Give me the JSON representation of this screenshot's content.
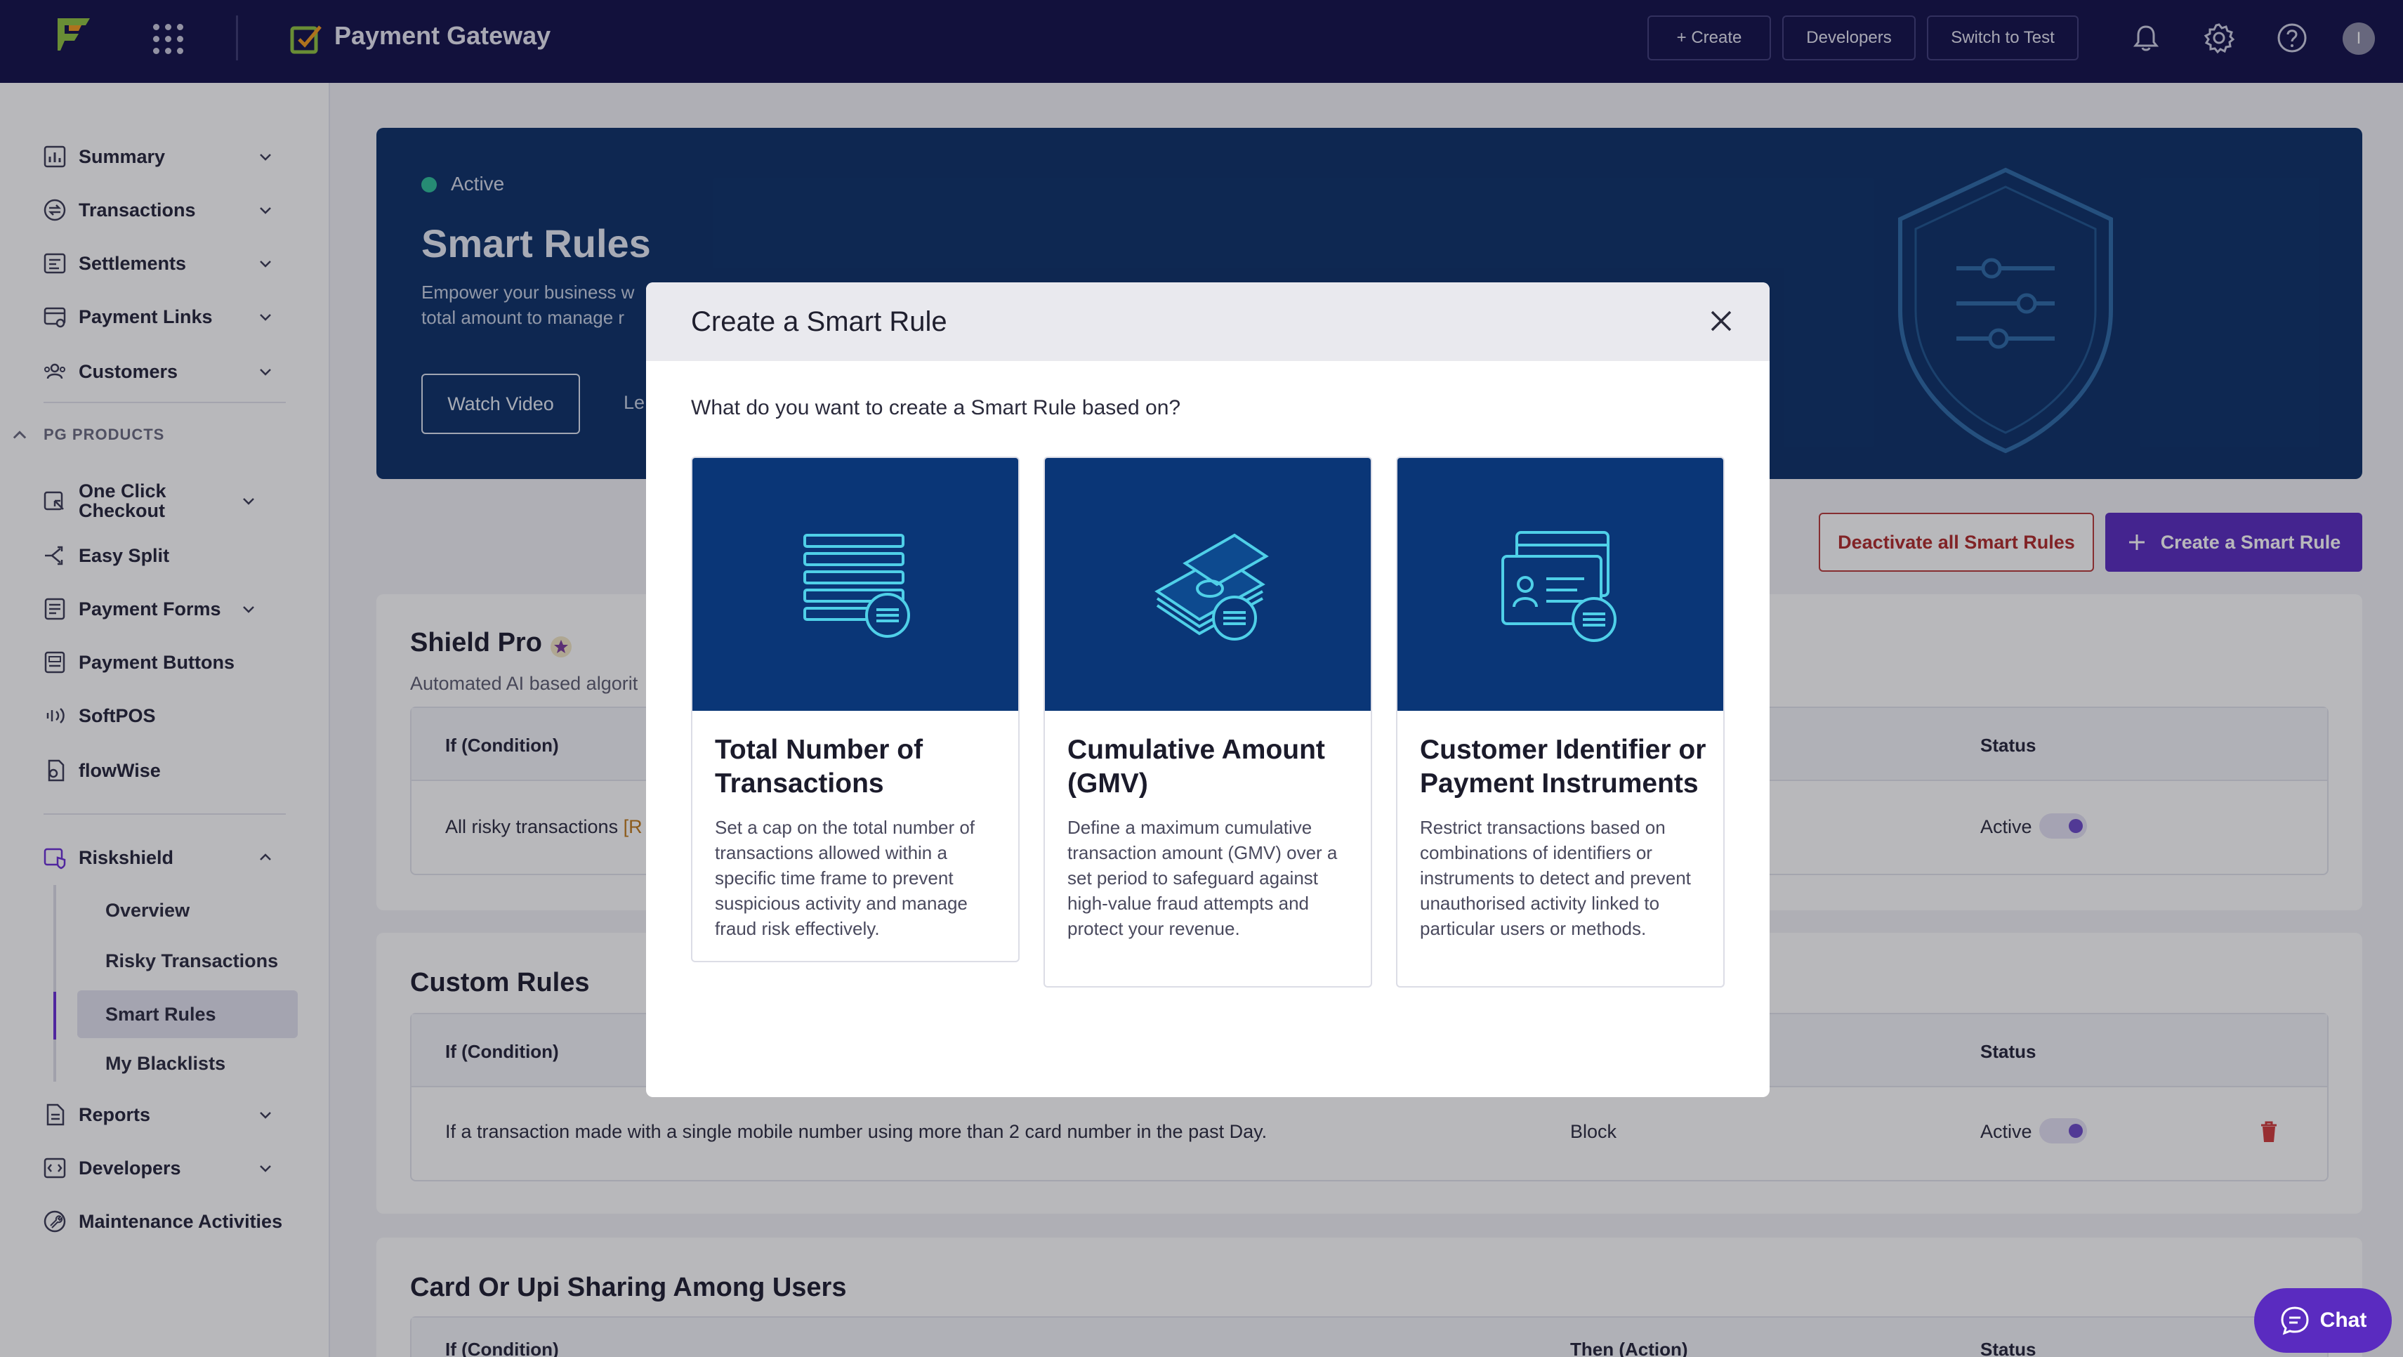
{
  "topnav": {
    "app_title": "Payment Gateway",
    "create_label": "+ Create",
    "developers_label": "Developers",
    "switch_label": "Switch to Test",
    "avatar_initial": "I"
  },
  "sidebar": {
    "items": [
      {
        "label": "Summary"
      },
      {
        "label": "Transactions"
      },
      {
        "label": "Settlements"
      },
      {
        "label": "Payment Links"
      },
      {
        "label": "Customers"
      }
    ],
    "section_label": "PG PRODUCTS",
    "products": [
      {
        "label": "One Click Checkout"
      },
      {
        "label": "Easy Split"
      },
      {
        "label": "Payment Forms"
      },
      {
        "label": "Payment Buttons"
      },
      {
        "label": "SoftPOS"
      },
      {
        "label": "flowWise"
      }
    ],
    "riskshield": {
      "label": "Riskshield",
      "sub": [
        "Overview",
        "Risky Transactions",
        "Smart Rules",
        "My Blacklists"
      ]
    },
    "bottom": [
      {
        "label": "Reports"
      },
      {
        "label": "Developers"
      },
      {
        "label": "Maintenance Activities"
      }
    ]
  },
  "hero": {
    "status": "Active",
    "title": "Smart Rules",
    "desc_line1": "Empower your business w",
    "desc_line2": "total amount to manage r",
    "watch_label": "Watch Video",
    "learn_label": "Le"
  },
  "actions": {
    "deactivate_label": "Deactivate all Smart Rules",
    "create_label": "Create a Smart Rule"
  },
  "shield_pro": {
    "title": "Shield Pro",
    "subtitle": "Automated AI based algorit",
    "col_condition": "If (Condition)",
    "col_status": "Status",
    "row_condition": "All risky transactions",
    "row_condition_tag": "[R",
    "row_status": "Active"
  },
  "custom_rules": {
    "title": "Custom Rules",
    "col_condition": "If (Condition)",
    "col_status": "Status",
    "row_condition": "If a transaction made with a single mobile number using more than 2 card number in the past Day.",
    "row_action": "Block",
    "row_status": "Active"
  },
  "card_upi": {
    "title": "Card Or Upi Sharing Among Users",
    "col_condition": "If (Condition)",
    "col_action": "Then (Action)",
    "col_status": "Status"
  },
  "modal": {
    "title": "Create a Smart Rule",
    "question": "What do you want to create a Smart Rule based on?",
    "options": [
      {
        "title": "Total Number of Transactions",
        "desc": "Set a cap on the total number of transactions allowed within a specific time frame to prevent suspicious activity and manage fraud risk effectively."
      },
      {
        "title": "Cumulative Amount (GMV)",
        "desc": "Define a maximum cumulative transaction amount (GMV) over a set period to safeguard against high-value fraud attempts and protect your revenue."
      },
      {
        "title": "Customer Identifier or Payment Instruments",
        "desc": "Restrict transactions based on combinations of identifiers or instruments to detect and prevent unauthorised activity linked to particular users or methods."
      }
    ]
  },
  "chat": {
    "label": "Chat"
  },
  "colors": {
    "nav_bg": "#12104a",
    "hero_bg": "#0c3068",
    "accent": "#5a2bc0",
    "danger": "#b02a2a",
    "option_bg": "#0a3677",
    "icon_glow": "#4fd0e8"
  }
}
